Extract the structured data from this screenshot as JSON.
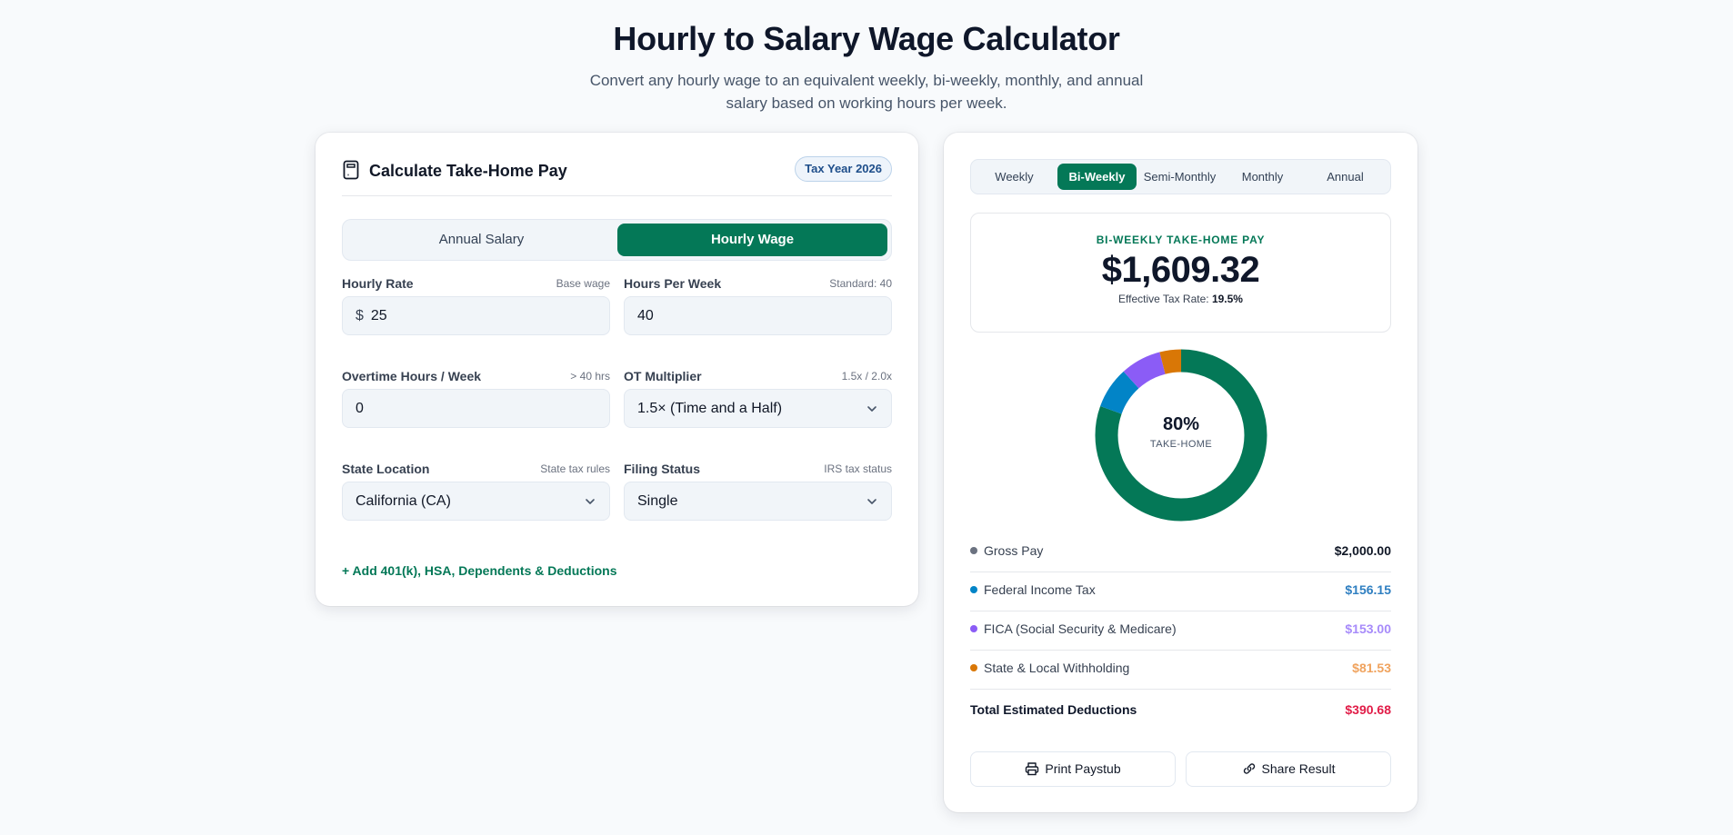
{
  "page": {
    "title": "Hourly to Salary Wage Calculator",
    "subtitle": "Convert any hourly wage to an equivalent weekly, bi-weekly, monthly, and annual salary based on working hours per week."
  },
  "left_card": {
    "title": "Calculate Take-Home Pay",
    "icon": "calculator-icon",
    "badge": "Tax Year 2026",
    "mode_toggle": {
      "annual_label": "Annual Salary",
      "hourly_label": "Hourly Wage",
      "active": "Hourly Wage"
    },
    "fields": {
      "hourly_rate": {
        "label": "Hourly Rate",
        "hint": "Base wage",
        "prefix": "$",
        "value": "25"
      },
      "hours_per_week": {
        "label": "Hours Per Week",
        "hint": "Standard: 40",
        "value": "40"
      },
      "overtime_hours": {
        "label": "Overtime Hours / Week",
        "hint": "> 40 hrs",
        "value": "0"
      },
      "ot_multiplier": {
        "label": "OT Multiplier",
        "hint": "1.5x / 2.0x",
        "value": "1.5× (Time and a Half)"
      },
      "state_location": {
        "label": "State Location",
        "hint": "State tax rules",
        "value": "California (CA)"
      },
      "filing_status": {
        "label": "Filing Status",
        "hint": "IRS tax status",
        "value": "Single"
      }
    },
    "add_link": "+ Add 401(k), HSA, Dependents & Deductions"
  },
  "right_card": {
    "period_tabs": [
      "Weekly",
      "Bi-Weekly",
      "Semi-Monthly",
      "Monthly",
      "Annual"
    ],
    "active_tab": "Bi-Weekly",
    "summary": {
      "caption": "BI-WEEKLY TAKE-HOME PAY",
      "amount": "$1,609.32",
      "rate_label": "Effective Tax Rate:",
      "rate_value": "19.5%"
    },
    "donut": {
      "center_value": "80%",
      "center_label": "TAKE-HOME",
      "segments": [
        {
          "name": "Take-Home",
          "fraction": 0.8047,
          "color": "#047857"
        },
        {
          "name": "Federal Income Tax",
          "fraction": 0.0781,
          "color": "#0284c7"
        },
        {
          "name": "FICA",
          "fraction": 0.0765,
          "color": "#8b5cf6"
        },
        {
          "name": "State & Local",
          "fraction": 0.0408,
          "color": "#d97706"
        }
      ]
    },
    "breakdown": [
      {
        "name": "Gross Pay",
        "value": "$2,000.00",
        "dot_color": "#6b7280",
        "value_color": "#111827"
      },
      {
        "name": "Federal Income Tax",
        "value": "$156.15",
        "dot_color": "#0284c7",
        "value_color": "#2f7fc1"
      },
      {
        "name": "FICA (Social Security & Medicare)",
        "value": "$153.00",
        "dot_color": "#8b5cf6",
        "value_color": "#a78bfa"
      },
      {
        "name": "State & Local Withholding",
        "value": "$81.53",
        "dot_color": "#d97706",
        "value_color": "#f0a35e"
      }
    ],
    "total": {
      "name": "Total Estimated Deductions",
      "value": "$390.68"
    },
    "actions": {
      "print": "Print Paystub",
      "share": "Share Result"
    }
  }
}
